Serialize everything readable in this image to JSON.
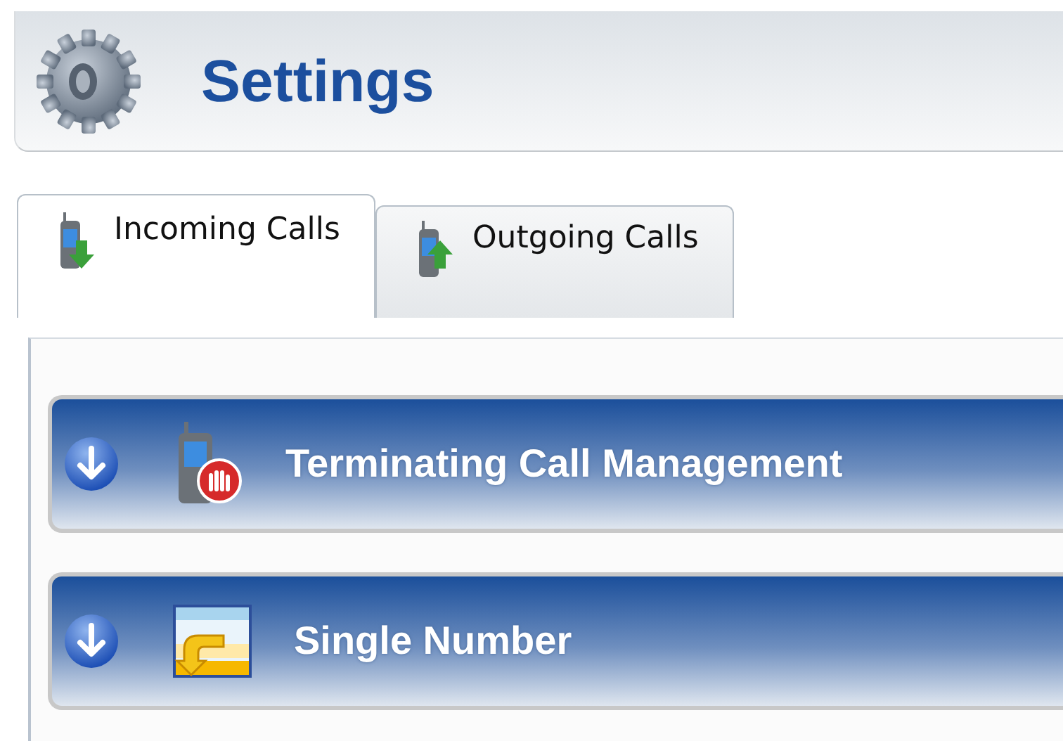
{
  "header": {
    "title": "Settings"
  },
  "tabs": [
    {
      "label": "Incoming Calls",
      "selected": true
    },
    {
      "label": "Outgoing Calls",
      "selected": false
    }
  ],
  "sections": [
    {
      "title": "Terminating Call Management"
    },
    {
      "title": "Single Number"
    }
  ]
}
